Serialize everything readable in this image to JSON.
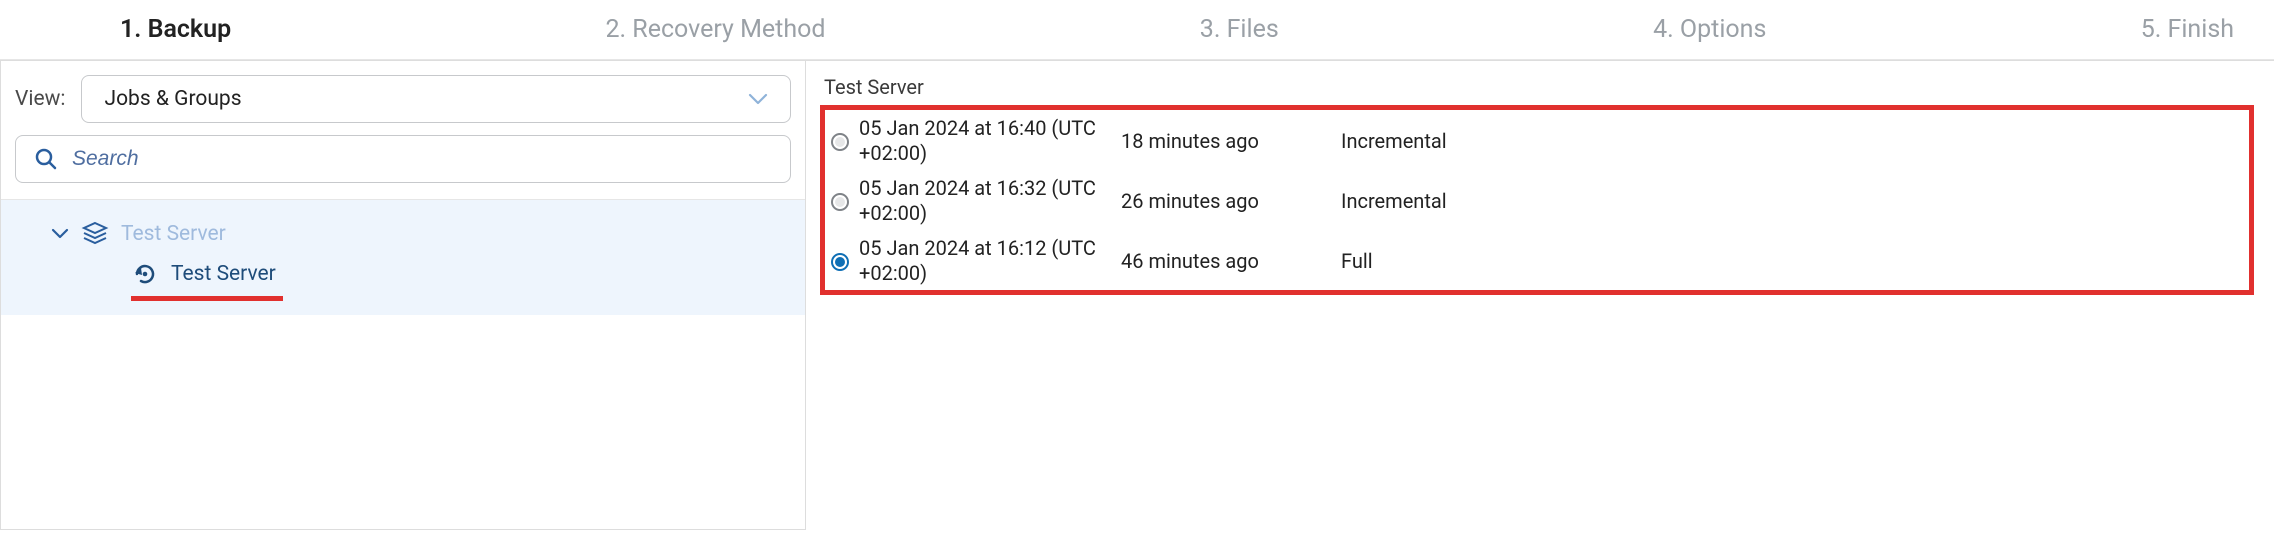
{
  "steps": [
    {
      "label": "1. Backup",
      "active": true
    },
    {
      "label": "2. Recovery Method",
      "active": false
    },
    {
      "label": "3. Files",
      "active": false
    },
    {
      "label": "4. Options",
      "active": false
    },
    {
      "label": "5. Finish",
      "active": false
    }
  ],
  "view": {
    "label": "View:",
    "selected": "Jobs & Groups"
  },
  "search": {
    "placeholder": "Search"
  },
  "tree": {
    "parent_label": "Test Server",
    "child_label": "Test Server"
  },
  "right": {
    "title": "Test Server",
    "points": [
      {
        "selected": false,
        "date": "05 Jan 2024 at 16:40 (UTC +02:00)",
        "age": "18 minutes ago",
        "type": "Incremental"
      },
      {
        "selected": false,
        "date": "05 Jan 2024 at 16:32 (UTC +02:00)",
        "age": "26 minutes ago",
        "type": "Incremental"
      },
      {
        "selected": true,
        "date": "05 Jan 2024 at 16:12 (UTC +02:00)",
        "age": "46 minutes ago",
        "type": "Full"
      }
    ]
  },
  "colors": {
    "highlight": "#e1302e",
    "accent": "#0f6fb5"
  }
}
